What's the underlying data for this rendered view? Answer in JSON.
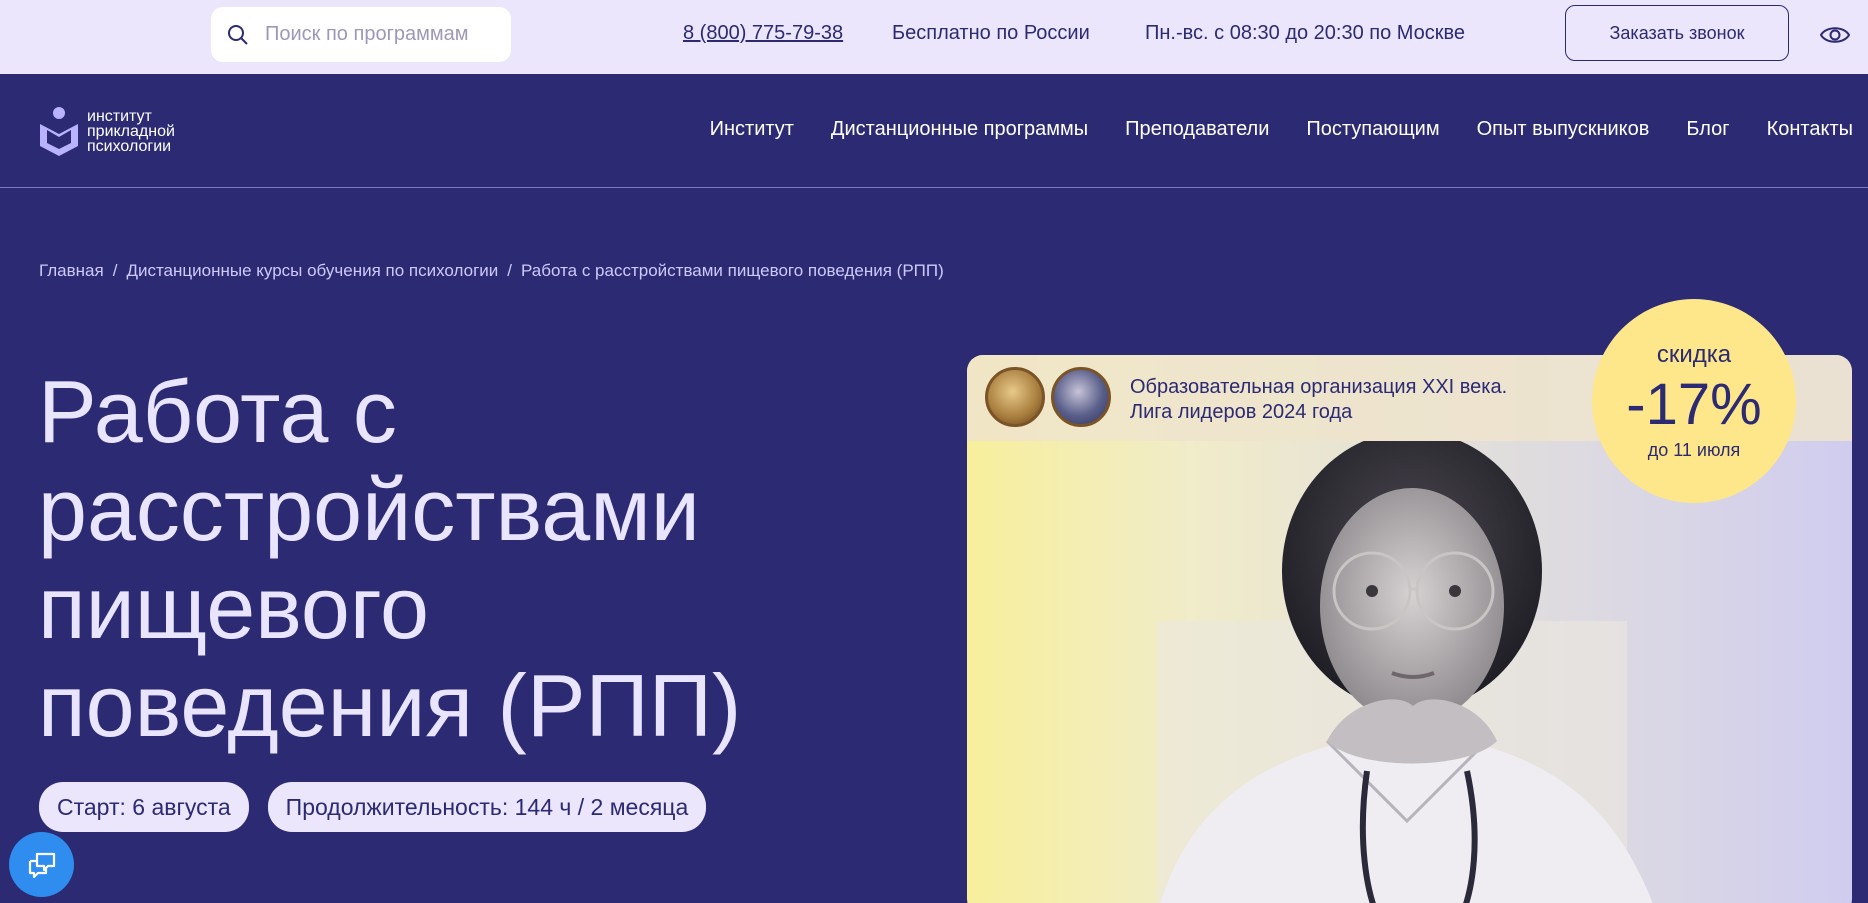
{
  "topbar": {
    "search_placeholder": "Поиск по программам",
    "phone": "8 (800) 775-79-38",
    "free_text": "Бесплатно по России",
    "hours": "Пн.-вс. с 08:30 до 20:30 по Москве",
    "callback_label": "Заказать звонок",
    "accessibility_icon": "eye-icon"
  },
  "logo": {
    "line1": "институт",
    "line2": "прикладной",
    "line3": "психологии"
  },
  "nav": {
    "items": [
      {
        "label": "Институт"
      },
      {
        "label": "Дистанционные программы"
      },
      {
        "label": "Преподаватели"
      },
      {
        "label": "Поступающим"
      },
      {
        "label": "Опыт выпускников"
      },
      {
        "label": "Блог"
      },
      {
        "label": "Контакты"
      }
    ]
  },
  "breadcrumb": {
    "items": [
      {
        "label": "Главная"
      },
      {
        "label": "Дистанционные курсы обучения по психологии"
      },
      {
        "label": "Работа с расстройствами пищевого поведения (РПП)"
      }
    ],
    "separator": "/"
  },
  "hero": {
    "title_lines": [
      "Работа с",
      "расстройствами",
      "пищевого",
      "поведения (РПП)"
    ],
    "start": "Старт: 6 августа",
    "duration": "Продолжительность: 144 ч / 2 месяца"
  },
  "card": {
    "caption_line1": "Образовательная организация XXI века.",
    "caption_line2": "Лига лидеров 2024 года"
  },
  "discount": {
    "label": "скидка",
    "value": "-17%",
    "until": "до 11 июля"
  },
  "colors": {
    "brand": "#2b2a72",
    "topbar_bg": "#ebe6fc",
    "accent_yellow": "#fde78a",
    "chat_blue": "#2f8df0"
  }
}
